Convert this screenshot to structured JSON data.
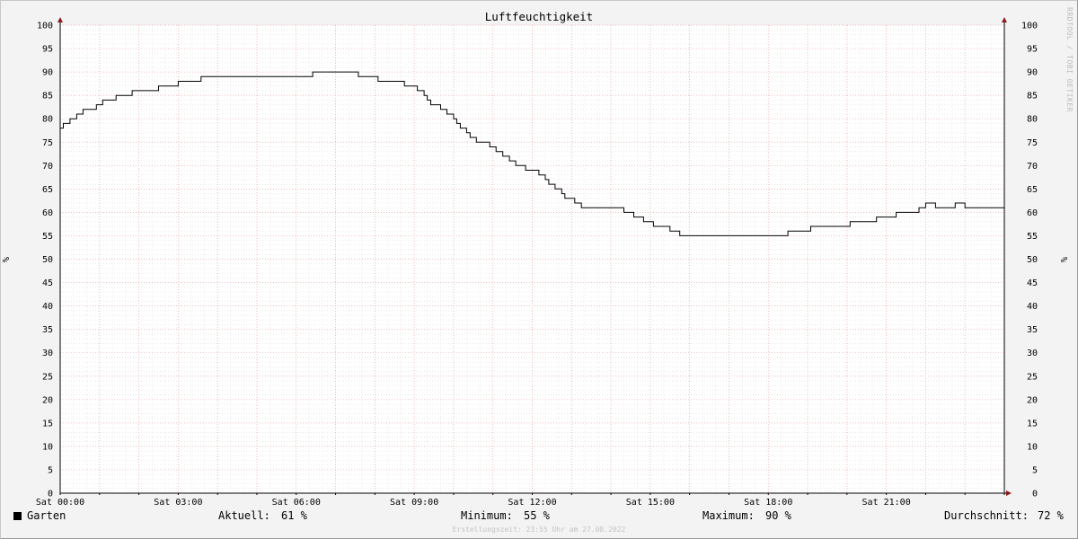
{
  "chart_data": {
    "type": "line",
    "title": "Luftfeuchtigkeit",
    "ylabel": "%",
    "ylabel_right": "%",
    "ylim": [
      0,
      100
    ],
    "y_ticks": [
      "0",
      "5",
      "10",
      "15",
      "20",
      "25",
      "30",
      "35",
      "40",
      "45",
      "50",
      "55",
      "60",
      "65",
      "70",
      "75",
      "80",
      "85",
      "90",
      "95",
      "100"
    ],
    "x_ticks": [
      "Sat 00:00",
      "Sat 03:00",
      "Sat 06:00",
      "Sat 09:00",
      "Sat 12:00",
      "Sat 15:00",
      "Sat 18:00",
      "Sat 21:00"
    ],
    "x_range_hours": [
      0,
      24
    ],
    "grid": true,
    "watermark": "RRDTOOL / TOBI OETIKER",
    "series": [
      {
        "name": "Garten",
        "color": "#000000",
        "points": [
          [
            0.0,
            78
          ],
          [
            0.08,
            79
          ],
          [
            0.25,
            80
          ],
          [
            0.42,
            81
          ],
          [
            0.58,
            82
          ],
          [
            0.92,
            83
          ],
          [
            1.08,
            84
          ],
          [
            1.42,
            85
          ],
          [
            1.83,
            86
          ],
          [
            2.5,
            87
          ],
          [
            3.0,
            88
          ],
          [
            3.58,
            89
          ],
          [
            6.42,
            90
          ],
          [
            7.58,
            89
          ],
          [
            8.08,
            88
          ],
          [
            8.75,
            87
          ],
          [
            9.08,
            86
          ],
          [
            9.25,
            85
          ],
          [
            9.33,
            84
          ],
          [
            9.42,
            83
          ],
          [
            9.67,
            82
          ],
          [
            9.83,
            81
          ],
          [
            10.0,
            80
          ],
          [
            10.08,
            79
          ],
          [
            10.17,
            78
          ],
          [
            10.33,
            77
          ],
          [
            10.42,
            76
          ],
          [
            10.58,
            75
          ],
          [
            10.92,
            74
          ],
          [
            11.08,
            73
          ],
          [
            11.25,
            72
          ],
          [
            11.42,
            71
          ],
          [
            11.58,
            70
          ],
          [
            11.83,
            69
          ],
          [
            12.17,
            68
          ],
          [
            12.33,
            67
          ],
          [
            12.42,
            66
          ],
          [
            12.58,
            65
          ],
          [
            12.75,
            64
          ],
          [
            12.83,
            63
          ],
          [
            13.08,
            62
          ],
          [
            13.25,
            61
          ],
          [
            14.33,
            60
          ],
          [
            14.58,
            59
          ],
          [
            14.83,
            58
          ],
          [
            15.08,
            57
          ],
          [
            15.5,
            56
          ],
          [
            15.75,
            55
          ],
          [
            18.5,
            56
          ],
          [
            19.08,
            57
          ],
          [
            20.08,
            58
          ],
          [
            20.75,
            59
          ],
          [
            21.25,
            60
          ],
          [
            21.83,
            61
          ],
          [
            22.0,
            62
          ],
          [
            22.25,
            61
          ],
          [
            22.75,
            62
          ],
          [
            23.0,
            61
          ],
          [
            24.0,
            61
          ]
        ]
      }
    ]
  },
  "legend": {
    "series_name": "Garten",
    "current_label": "Aktuell:",
    "current_value": "61 %",
    "min_label": "Minimum:",
    "min_value": "55 %",
    "max_label": "Maximum:",
    "max_value": "90 %",
    "avg_label": "Durchschnitt:",
    "avg_value": "72 %"
  },
  "footer": "Erstellungszeit: 23:55 Uhr am 27.08.2022"
}
